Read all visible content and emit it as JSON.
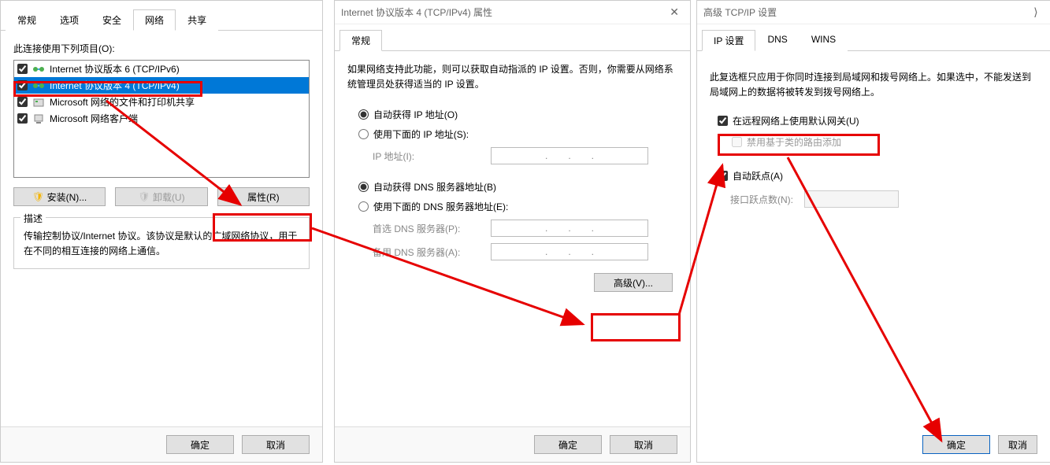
{
  "dlg1": {
    "tabs": [
      "常规",
      "选项",
      "安全",
      "网络",
      "共享"
    ],
    "active_tab_index": 3,
    "conn_label": "此连接使用下列项目(O):",
    "items": [
      {
        "label": "Internet 协议版本 6 (TCP/IPv6)",
        "checked": true,
        "selected": false
      },
      {
        "label": "Internet 协议版本 4 (TCP/IPv4)",
        "checked": true,
        "selected": true
      },
      {
        "label": "Microsoft 网络的文件和打印机共享",
        "checked": true,
        "selected": false
      },
      {
        "label": "Microsoft 网络客户端",
        "checked": true,
        "selected": false
      }
    ],
    "install_btn": "安装(N)...",
    "uninstall_btn": "卸载(U)",
    "properties_btn": "属性(R)",
    "desc_legend": "描述",
    "desc_text": "传输控制协议/Internet 协议。该协议是默认的广域网络协议，用于在不同的相互连接的网络上通信。",
    "ok": "确定",
    "cancel": "取消"
  },
  "dlg2": {
    "title": "Internet 协议版本 4 (TCP/IPv4) 属性",
    "tabs": [
      "常规"
    ],
    "intro": "如果网络支持此功能，则可以获取自动指派的 IP 设置。否则，你需要从网络系统管理员处获得适当的 IP 设置。",
    "ip_auto": "自动获得 IP 地址(O)",
    "ip_manual": "使用下面的 IP 地址(S):",
    "ip_label": "IP 地址(I):",
    "dns_auto": "自动获得 DNS 服务器地址(B)",
    "dns_manual": "使用下面的 DNS 服务器地址(E):",
    "dns_pref": "首选 DNS 服务器(P):",
    "dns_alt": "备用 DNS 服务器(A):",
    "advanced": "高级(V)...",
    "ok": "确定",
    "cancel": "取消"
  },
  "dlg3": {
    "title": "高级 TCP/IP 设置",
    "tabs": [
      "IP 设置",
      "DNS",
      "WINS"
    ],
    "desc": "此复选框只应用于你同时连接到局域网和拨号网络上。如果选中，不能发送到局域网上的数据将被转发到拨号网络上。",
    "gw_label": "在远程网络上使用默认网关(U)",
    "class_route": "禁用基于类的路由添加",
    "auto_metric": "自动跃点(A)",
    "interface_metric": "接口跃点数(N):",
    "ok": "确定",
    "cancel": "取消"
  }
}
